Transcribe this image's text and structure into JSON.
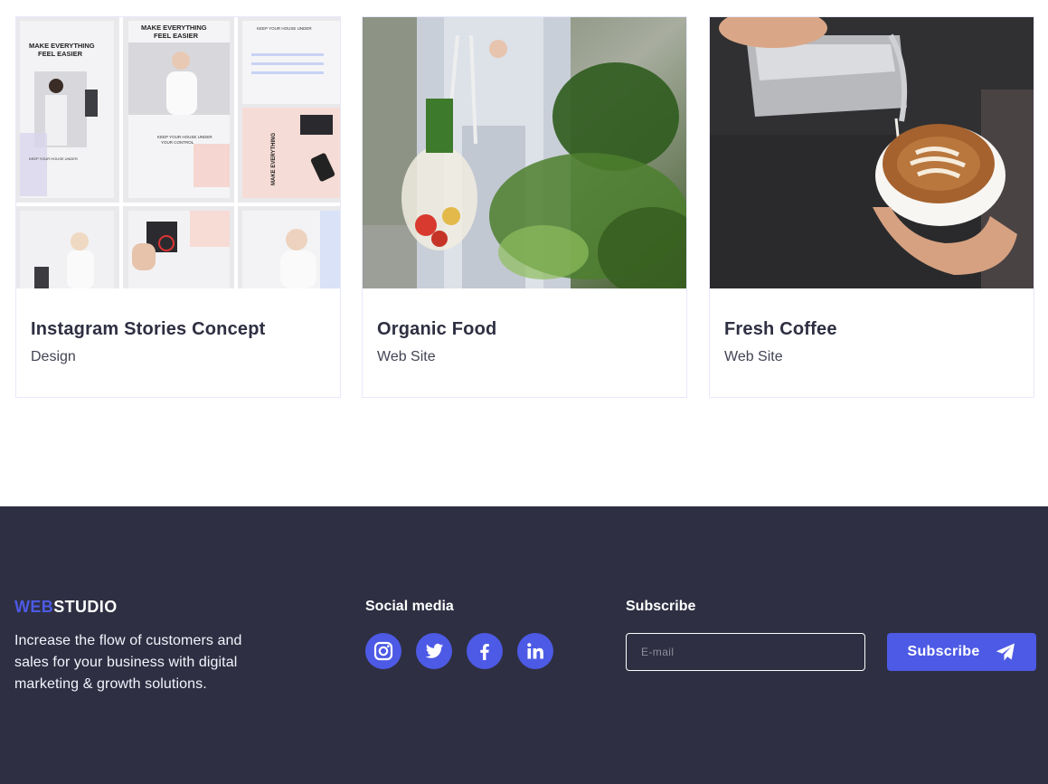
{
  "portfolio": {
    "cards": [
      {
        "title": "Instagram Stories Concept",
        "category": "Design",
        "image": "instagram-stories-mockup"
      },
      {
        "title": "Organic Food",
        "category": "Web Site",
        "image": "woman-with-grocery-net-bag"
      },
      {
        "title": "Fresh Coffee",
        "category": "Web Site",
        "image": "latte-art-pour"
      }
    ],
    "stories_mockup_text": {
      "headline": "MAKE EVERYTHING FEEL EASIER",
      "house": "KEEP YOUR HOUSE UNDER YOUR CONTROL",
      "tech": "SMART TECHNOLOGY"
    }
  },
  "footer": {
    "logo_accent": "WEB",
    "logo_rest": "STUDIO",
    "description": "Increase the flow of customers and sales for your business with digital marketing & growth solutions.",
    "social_title": "Social media",
    "socials": [
      {
        "icon": "instagram-icon"
      },
      {
        "icon": "twitter-icon"
      },
      {
        "icon": "facebook-icon"
      },
      {
        "icon": "linkedin-icon"
      }
    ],
    "subscribe_title": "Subscribe",
    "email_placeholder": "E-mail",
    "subscribe_button": "Subscribe"
  },
  "colors": {
    "accent": "#4d5ae5",
    "footer_bg": "#2e2f42",
    "heading": "#2e2f42",
    "text": "#434455",
    "border": "#e7e9fc"
  }
}
